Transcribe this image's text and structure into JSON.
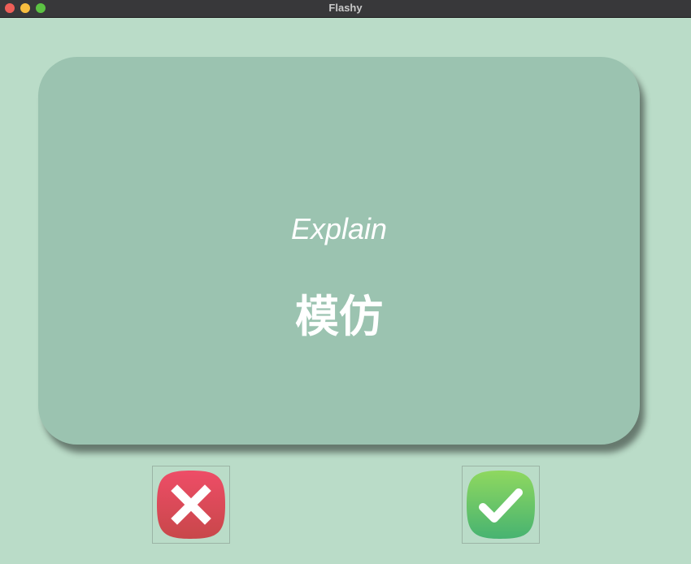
{
  "window": {
    "title": "Flashy"
  },
  "card": {
    "prompt": "Explain",
    "word": "模仿"
  },
  "buttons": {
    "wrong_icon": "x-mark-icon",
    "right_icon": "checkmark-icon"
  },
  "colors": {
    "background": "#badcc8",
    "card": "#9bc3b0",
    "wrong_top": "#ee4d67",
    "wrong_bottom": "#c8474a",
    "right_top": "#8fd85f",
    "right_bottom": "#47b371"
  }
}
